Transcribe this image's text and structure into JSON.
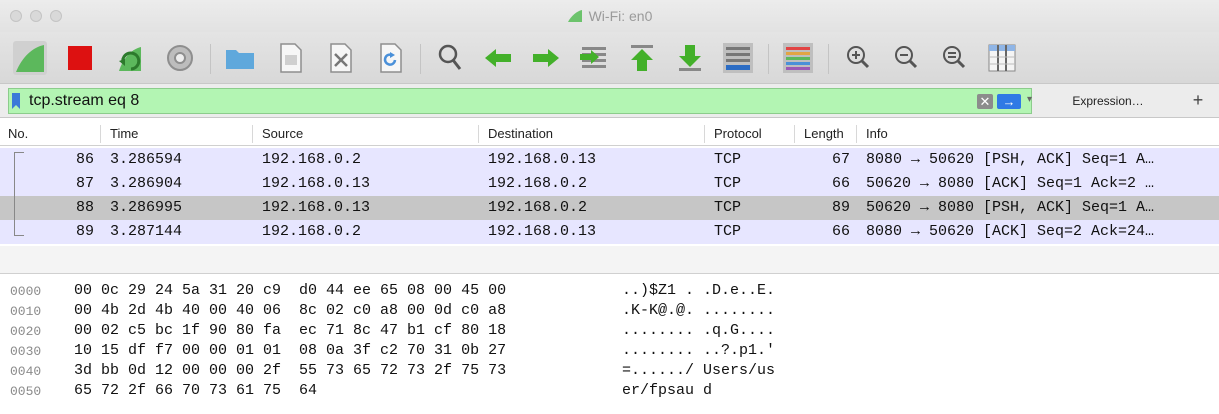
{
  "window": {
    "title": "Wi-Fi: en0"
  },
  "toolbar": {
    "buttons": [
      {
        "name": "start-capture",
        "icon": "shark-fin-icon"
      },
      {
        "name": "stop-capture",
        "icon": "stop-icon"
      },
      {
        "name": "restart-capture",
        "icon": "restart-fin-icon"
      },
      {
        "name": "capture-options",
        "icon": "gear-icon"
      },
      {
        "name": "open-file",
        "icon": "folder-icon"
      },
      {
        "name": "save-file",
        "icon": "file-icon"
      },
      {
        "name": "close-file",
        "icon": "close-file-icon"
      },
      {
        "name": "reload-file",
        "icon": "reload-icon"
      },
      {
        "name": "find-packet",
        "icon": "search-icon"
      },
      {
        "name": "go-back",
        "icon": "arrow-left-icon"
      },
      {
        "name": "go-forward",
        "icon": "arrow-right-icon"
      },
      {
        "name": "go-to-packet",
        "icon": "goto-icon"
      },
      {
        "name": "go-first",
        "icon": "arrow-up-icon"
      },
      {
        "name": "go-last",
        "icon": "arrow-down-icon"
      },
      {
        "name": "auto-scroll",
        "icon": "autoscroll-icon"
      },
      {
        "name": "colorize",
        "icon": "colorize-icon"
      },
      {
        "name": "zoom-in",
        "icon": "zoom-in-icon"
      },
      {
        "name": "zoom-out",
        "icon": "zoom-out-icon"
      },
      {
        "name": "normal-size",
        "icon": "zoom-reset-icon"
      },
      {
        "name": "resize-columns",
        "icon": "resize-columns-icon"
      }
    ]
  },
  "filter": {
    "value": "tcp.stream eq 8",
    "clear_glyph": "✕",
    "apply_glyph": "→",
    "dropdown_glyph": "▾",
    "expression_label": "Expression…",
    "add_label": "+"
  },
  "columns": {
    "no": "No.",
    "time": "Time",
    "source": "Source",
    "destination": "Destination",
    "protocol": "Protocol",
    "length": "Length",
    "info": "Info"
  },
  "packets": [
    {
      "no": "86",
      "time": "3.286594",
      "source": "192.168.0.2",
      "destination": "192.168.0.13",
      "protocol": "TCP",
      "length": "67",
      "info": "8080 → 50620 [PSH, ACK] Seq=1 A…",
      "selected": false
    },
    {
      "no": "87",
      "time": "3.286904",
      "source": "192.168.0.13",
      "destination": "192.168.0.2",
      "protocol": "TCP",
      "length": "66",
      "info": "50620 → 8080 [ACK] Seq=1 Ack=2 …",
      "selected": false
    },
    {
      "no": "88",
      "time": "3.286995",
      "source": "192.168.0.13",
      "destination": "192.168.0.2",
      "protocol": "TCP",
      "length": "89",
      "info": "50620 → 8080 [PSH, ACK] Seq=1 A…",
      "selected": true
    },
    {
      "no": "89",
      "time": "3.287144",
      "source": "192.168.0.2",
      "destination": "192.168.0.13",
      "protocol": "TCP",
      "length": "66",
      "info": "8080 → 50620 [ACK] Seq=2 Ack=24…",
      "selected": false
    }
  ],
  "hex_dump": [
    {
      "offset": "0000",
      "bytes": "00 0c 29 24 5a 31 20 c9  d0 44 ee 65 08 00 45 00",
      "ascii": "..)$Z1 . .D.e..E."
    },
    {
      "offset": "0010",
      "bytes": "00 4b 2d 4b 40 00 40 06  8c 02 c0 a8 00 0d c0 a8",
      "ascii": ".K-K@.@. ........"
    },
    {
      "offset": "0020",
      "bytes": "00 02 c5 bc 1f 90 80 fa  ec 71 8c 47 b1 cf 80 18",
      "ascii": "........ .q.G...."
    },
    {
      "offset": "0030",
      "bytes": "10 15 df f7 00 00 01 01  08 0a 3f c2 70 31 0b 27",
      "ascii": "........ ..?.p1.'"
    },
    {
      "offset": "0040",
      "bytes": "3d bb 0d 12 00 00 00 2f  55 73 65 72 73 2f 75 73",
      "ascii": "=....../ Users/us"
    },
    {
      "offset": "0050",
      "bytes": "65 72 2f 66 70 73 61 75  64",
      "ascii": "er/fpsau d"
    }
  ],
  "colors": {
    "row_bg": "#e7e6ff",
    "row_selected_bg": "#c6c6c6",
    "filter_valid_bg": "#b3f5b3",
    "shark_fin": "#5cb85c",
    "stop": "#dd1111"
  }
}
